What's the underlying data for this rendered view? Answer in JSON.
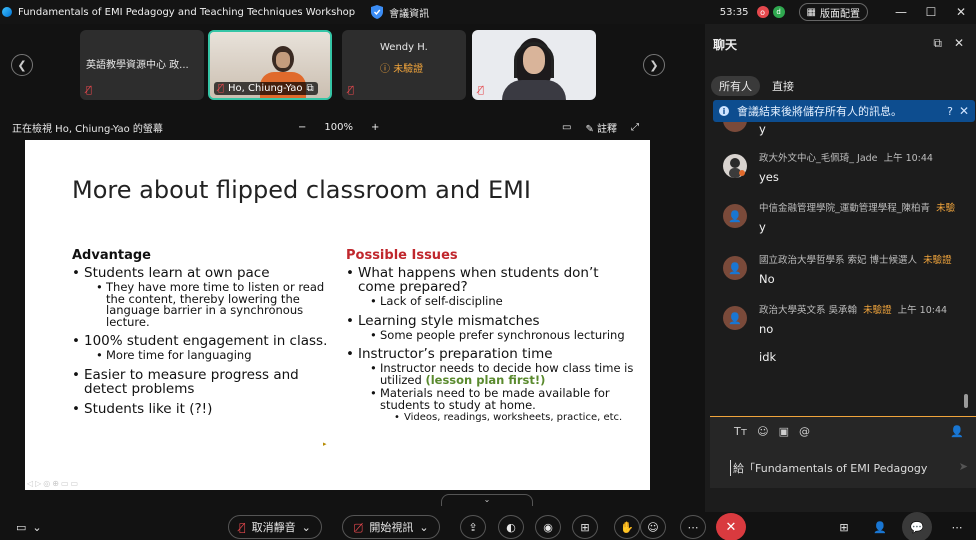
{
  "titlebar": {
    "title": "Fundamentals of EMI Pedagogy and Teaching Techniques Workshop",
    "meeting_info": "會議資訊",
    "timer": "53:35",
    "layout_label": "版面配置"
  },
  "strip": {
    "tiles": [
      {
        "name": "英語教學資源中心 政..."
      },
      {
        "name": "Ho, Chiung-Yao"
      },
      {
        "name": "Wendy H.",
        "status": "未驗證"
      },
      {
        "name": ""
      }
    ]
  },
  "viewbar": {
    "viewing": "正在檢視 Ho, Chiung-Yao 的螢幕",
    "zoom_minus": "−",
    "zoom_level": "100%",
    "zoom_plus": "+",
    "annotate": "註釋"
  },
  "slide": {
    "title": "More about flipped classroom and EMI",
    "left_head": "Advantage",
    "left": [
      "Students learn at own pace",
      "They have more time to listen or read the content, thereby lowering the language barrier in a synchronous lecture.",
      "100% student engagement in class.",
      "More time for languaging",
      "Easier to measure progress and detect problems",
      "Students like it (?!)"
    ],
    "right_head": "Possible Issues",
    "right": [
      "What happens when students don’t come prepared?",
      "Lack of self-discipline",
      "Learning style mismatches",
      "Some people prefer synchronous lecturing",
      "Instructor’s preparation time",
      "Instructor needs to decide how class time is utilized",
      "(lesson plan first!)",
      "Materials need to be made available for students to study at home.",
      "Videos, readings, worksheets, practice, etc."
    ]
  },
  "chat": {
    "title": "聊天",
    "tab_all": "所有人",
    "tab_direct": "直接",
    "notice": "會議結束後將儲存所有人的訊息。",
    "messages": [
      {
        "sender": "",
        "verified": "",
        "time": "",
        "text": "y"
      },
      {
        "sender": "政大外文中心_毛佩琦_ Jade",
        "verified": "",
        "time": "上午 10:44",
        "text": "yes"
      },
      {
        "sender": "中信金融管理學院_運動管理學程_陳柏青",
        "verified": "未驗",
        "time": "",
        "text": "y"
      },
      {
        "sender": "國立政治大學哲學系 索妃 博士候選人",
        "verified": "未驗證",
        "time": "",
        "text": "No"
      },
      {
        "sender": "政治大學英文系 吳承翰",
        "verified": "未驗證",
        "time": "上午 10:44",
        "text": "no"
      },
      {
        "sender": "",
        "verified": "",
        "time": "",
        "text": "idk"
      }
    ],
    "compose_placeholder": "給「Fundamentals of EMI Pedagogy"
  },
  "toolbar": {
    "unmute": "取消靜音",
    "start_video": "開始視訊"
  },
  "colors": {
    "accent_teal": "#35c5a6",
    "warning": "#f0a43c",
    "end_red": "#d93a3f",
    "notice_blue": "#0d4d8f",
    "issues_red": "#c0272d",
    "lesson_green": "#5a8a2e"
  }
}
